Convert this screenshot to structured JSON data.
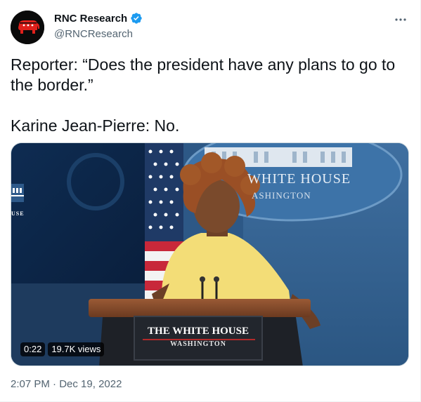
{
  "author": {
    "display_name": "RNC Research",
    "handle": "@RNCResearch",
    "verified": true,
    "avatar_icon": "republican-elephant-icon"
  },
  "tweet": {
    "text": "Reporter: “Does the president have any plans to go to the border.”\n\nKarine Jean-Pierre: No."
  },
  "video": {
    "duration": "0:22",
    "views": "19.7K views",
    "podium_title": "THE WHITE HOUSE",
    "podium_subtitle": "WASHINGTON",
    "backdrop_title": "WHITE HOUSE",
    "backdrop_subtitle": "ASHINGTON",
    "left_panel_text": "USE"
  },
  "meta": {
    "time": "2:07 PM",
    "separator": "·",
    "date": "Dec 19, 2022"
  },
  "colors": {
    "verified_blue": "#1d9bf0",
    "secondary_text": "#536471",
    "avatar_red": "#e0201b"
  }
}
